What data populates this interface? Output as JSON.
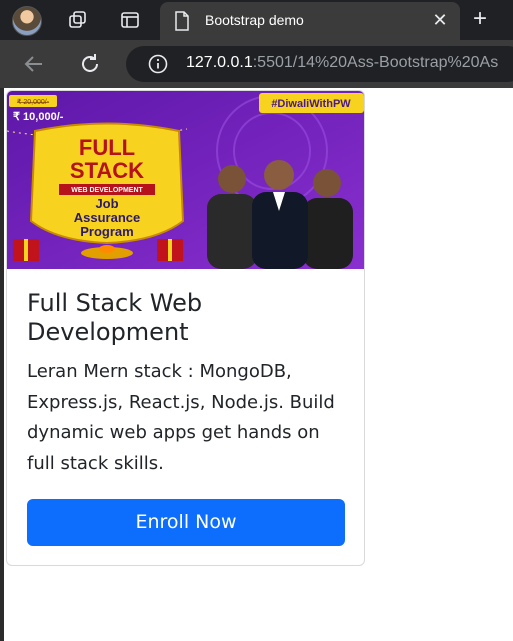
{
  "browser": {
    "tab_title": "Bootstrap demo",
    "url_host": "127.0.0.1",
    "url_rest": ":5501/14%20Ass-Bootstrap%20As"
  },
  "card": {
    "banner": {
      "hashtag": "#DiwaliWithPW",
      "old_price": "₹ 20,000/-",
      "new_price": "₹ 10,000/-",
      "line1": "FULL",
      "line2": "STACK",
      "ribbon": "WEB DEVELOPMENT",
      "line3": "Job",
      "line4": "Assurance",
      "line5": "Program"
    },
    "title": "Full Stack Web Development",
    "text": "Leran Mern stack : MongoDB, Express.js, React.js, Node.js. Build dynamic web apps get hands on full stack skills.",
    "button_label": "Enroll Now"
  },
  "colors": {
    "primary": "#0d6efd",
    "banner_purple": "#6b1fb8",
    "banner_yellow": "#f7d21e"
  }
}
